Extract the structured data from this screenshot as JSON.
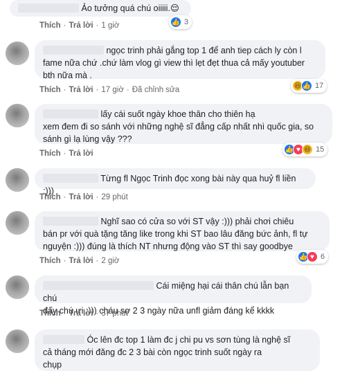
{
  "comments": [
    {
      "text": "Ảo tưởng quá chú oiiiii.😌",
      "reaction_count": "3",
      "actions": {
        "like": "Thích",
        "reply": "Trả lời",
        "time": "1 giờ",
        "edited": ""
      }
    },
    {
      "text": "ngọc trinh phải gắng top 1 để anh tiep cách ly còn l\nfame nữa chứ .chứ làm vlog gì view thì lẹt đẹt thua cả mấy youtuber\nbth nữa mà .",
      "reaction_count": "17",
      "actions": {
        "like": "Thích",
        "reply": "Trả lời",
        "time": "17 giờ",
        "edited": "Đã chỉnh sửa"
      }
    },
    {
      "text": "lấy cái suốt ngày khoe thân cho thiên hạ\nxem đem đi so sánh với những nghệ sĩ đẳng cấp nhất nhì quốc gia, so\nsánh gì lạ lùng vậy ???",
      "reaction_count": "15",
      "actions": {
        "like": "Thích",
        "reply": "Trả lời",
        "time": "",
        "edited": ""
      }
    },
    {
      "text": "Từng fl Ngọc Trinh đọc xong bài này qua huỷ fl liền :)))",
      "reaction_count": "",
      "actions": {
        "like": "Thích",
        "reply": "Trả lời",
        "time": "29 phút",
        "edited": ""
      }
    },
    {
      "text": "Nghĩ sao có cửa so với ST vậy :))) phải chơi chiêu\nbán pr với quà tặng tăng like trong khi ST bao lâu đăng bức ảnh, fl tự\nnguyện :))) đúng là thích NT nhưng động vào ST thì say goodbye",
      "reaction_count": "6",
      "actions": {
        "like": "Thích",
        "reply": "Trả lời",
        "time": "2 giờ",
        "edited": ""
      }
    },
    {
      "text": "Cái miệng hại cái thân chú lẫn bạn chú\nđấy chú ưi :))) cháu sợ 2 3 ngày nữa unfl giảm đáng kể kkkk",
      "reaction_count": "",
      "actions": {
        "like": "Thích",
        "reply": "Trả lời",
        "time": "37 phút",
        "edited": ""
      }
    },
    {
      "text": "Óc lên đc top 1 làm đc j chi pu vs sơn tùng là nghệ sĩ\ncả tháng mới đăng đc 2 3 bài còn ngọc trinh suốt ngày ra\nchụp",
      "reaction_count": "",
      "actions": {
        "like": "Thích",
        "reply": "Trả lời",
        "time": "",
        "edited": ""
      }
    }
  ],
  "colors": {
    "bubble": "#f0f2f5",
    "meta": "#65676b",
    "like_blue": "#1877f2",
    "love_red": "#f33e58",
    "haha_yellow": "#f7b928"
  },
  "icons": [
    "like-reaction-icon",
    "love-reaction-icon",
    "haha-reaction-icon",
    "wow-reaction-icon"
  ]
}
